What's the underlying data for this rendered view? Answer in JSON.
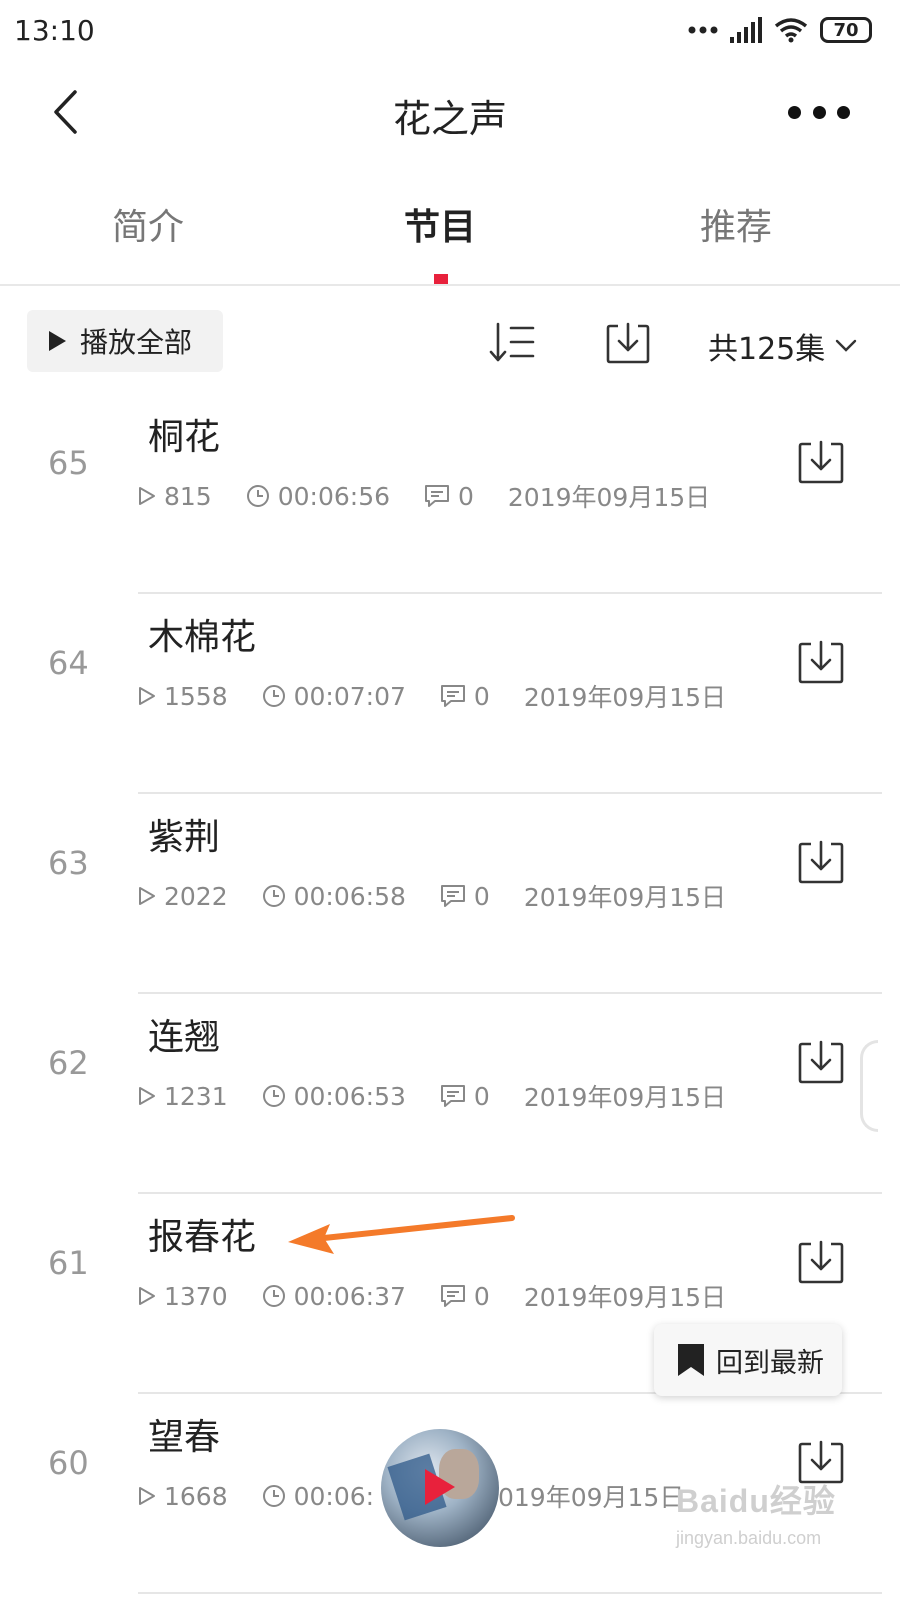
{
  "status_bar": {
    "time": "13:10",
    "battery": "70"
  },
  "header": {
    "title": "花之声"
  },
  "tabs": [
    {
      "label": "简介",
      "active": false
    },
    {
      "label": "节目",
      "active": true
    },
    {
      "label": "推荐",
      "active": false
    }
  ],
  "toolbar": {
    "play_all_label": "播放全部",
    "episode_count": "共125集"
  },
  "episodes": [
    {
      "num": "65",
      "title": "桐花",
      "plays": "815",
      "duration": "00:06:56",
      "comments": "0",
      "date": "2019年09月15日"
    },
    {
      "num": "64",
      "title": "木棉花",
      "plays": "1558",
      "duration": "00:07:07",
      "comments": "0",
      "date": "2019年09月15日"
    },
    {
      "num": "63",
      "title": "紫荆",
      "plays": "2022",
      "duration": "00:06:58",
      "comments": "0",
      "date": "2019年09月15日"
    },
    {
      "num": "62",
      "title": "连翘",
      "plays": "1231",
      "duration": "00:06:53",
      "comments": "0",
      "date": "2019年09月15日"
    },
    {
      "num": "61",
      "title": "报春花",
      "plays": "1370",
      "duration": "00:06:37",
      "comments": "0",
      "date": "2019年09月15日"
    },
    {
      "num": "60",
      "title": "望春",
      "plays": "1668",
      "duration": "00:06:",
      "comments": "",
      "date": "2019年09月15日"
    }
  ],
  "float_button": {
    "label": "回到最新"
  },
  "watermark": {
    "logo": "Baidu经验",
    "url": "jingyan.baidu.com"
  },
  "colors": {
    "accent": "#e8213c",
    "annotation_arrow": "#f47a2a"
  }
}
